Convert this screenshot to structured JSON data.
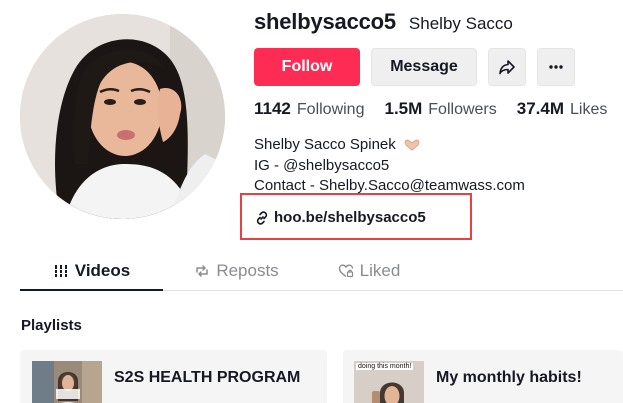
{
  "profile": {
    "username": "shelbysacco5",
    "display_name": "Shelby Sacco"
  },
  "actions": {
    "follow_label": "Follow",
    "message_label": "Message"
  },
  "stats": {
    "following_count": "1142",
    "following_label": "Following",
    "followers_count": "1.5M",
    "followers_label": "Followers",
    "likes_count": "37.4M",
    "likes_label": "Likes"
  },
  "bio": {
    "line1": "Shelby Sacco Spinek",
    "line2": "IG - @shelbysacco5",
    "line3": "Contact - Shelby.Sacco@teamwass.com",
    "link": "hoo.be/shelbysacco5"
  },
  "tabs": [
    {
      "label": "Videos",
      "icon": "grid-icon"
    },
    {
      "label": "Reposts",
      "icon": "repost-icon"
    },
    {
      "label": "Liked",
      "icon": "heart-lock-icon"
    }
  ],
  "playlists": {
    "title": "Playlists",
    "items": [
      {
        "name": "S2S HEALTH PROGRAM"
      },
      {
        "name": "My monthly habits!",
        "thumb_caption": "doing this month!"
      }
    ]
  },
  "colors": {
    "follow_button": "#fe2c55",
    "highlight_box": "#e8413f",
    "text_primary": "#161823",
    "text_secondary": "#4b4d56"
  }
}
